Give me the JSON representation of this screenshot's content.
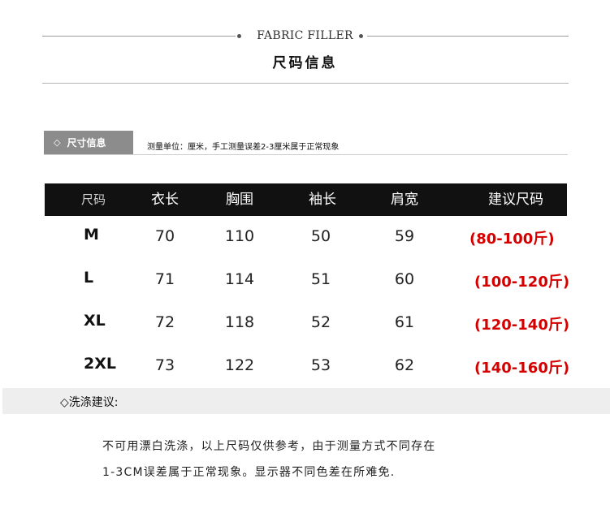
{
  "header": {
    "subtitle": "FABRIC FILLER",
    "title": "尺码信息"
  },
  "section": {
    "tag_symbol": "◇",
    "tag_label": "尺寸信息",
    "unit_note": "测量单位：厘米，手工测量误差2-3厘米属于正常现象"
  },
  "table": {
    "headers": [
      "尺码",
      "衣长",
      "胸围",
      "袖长",
      "肩宽",
      "建议尺码"
    ],
    "rows": [
      {
        "size": "M",
        "length": "70",
        "chest": "110",
        "sleeve": "50",
        "shoulder": "59",
        "recommend": "(80-100斤)"
      },
      {
        "size": "L",
        "length": "71",
        "chest": "114",
        "sleeve": "51",
        "shoulder": "60",
        "recommend": "(100-120斤)"
      },
      {
        "size": "XL",
        "length": "72",
        "chest": "118",
        "sleeve": "52",
        "shoulder": "61",
        "recommend": "(120-140斤)"
      },
      {
        "size": "2XL",
        "length": "73",
        "chest": "122",
        "sleeve": "53",
        "shoulder": "62",
        "recommend": "(140-160斤)"
      }
    ]
  },
  "wash": {
    "title": "◇洗涤建议:",
    "lines": [
      "不可用漂白洗涤，以上尺码仅供参考，由于测量方式不同存在",
      "1-3CM误差属于正常现象。显示器不同色差在所难免."
    ]
  },
  "colors": {
    "header_bar": "#111111",
    "section_tag": "#8c8c8c",
    "recommend_text": "#d40000"
  }
}
